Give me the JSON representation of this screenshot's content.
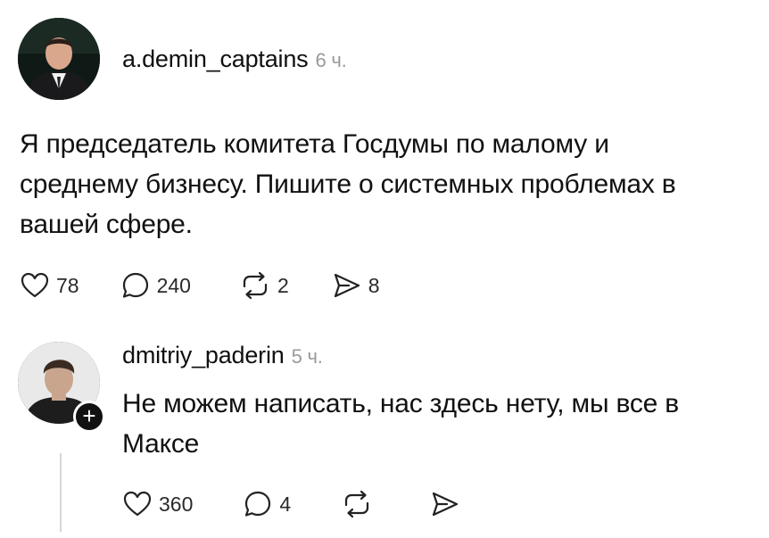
{
  "post": {
    "username": "a.demin_captains",
    "time": "6 ч.",
    "text": "Я председатель комитета Госдумы по малому и среднему бизнесу. Пишите о системных проблемах в вашей сфере.",
    "likes": "78",
    "replies": "240",
    "reposts": "2",
    "shares": "8"
  },
  "reply": {
    "username": "dmitriy_paderin",
    "time": "5 ч.",
    "text": "Не можем написать, нас здесь нету, мы все в Максе",
    "likes": "360",
    "replies": "4",
    "follow_badge": "+"
  },
  "icons": {
    "like": "heart-icon",
    "reply": "comment-bubble-icon",
    "repost": "repost-icon",
    "share": "send-icon",
    "follow": "plus-icon"
  }
}
